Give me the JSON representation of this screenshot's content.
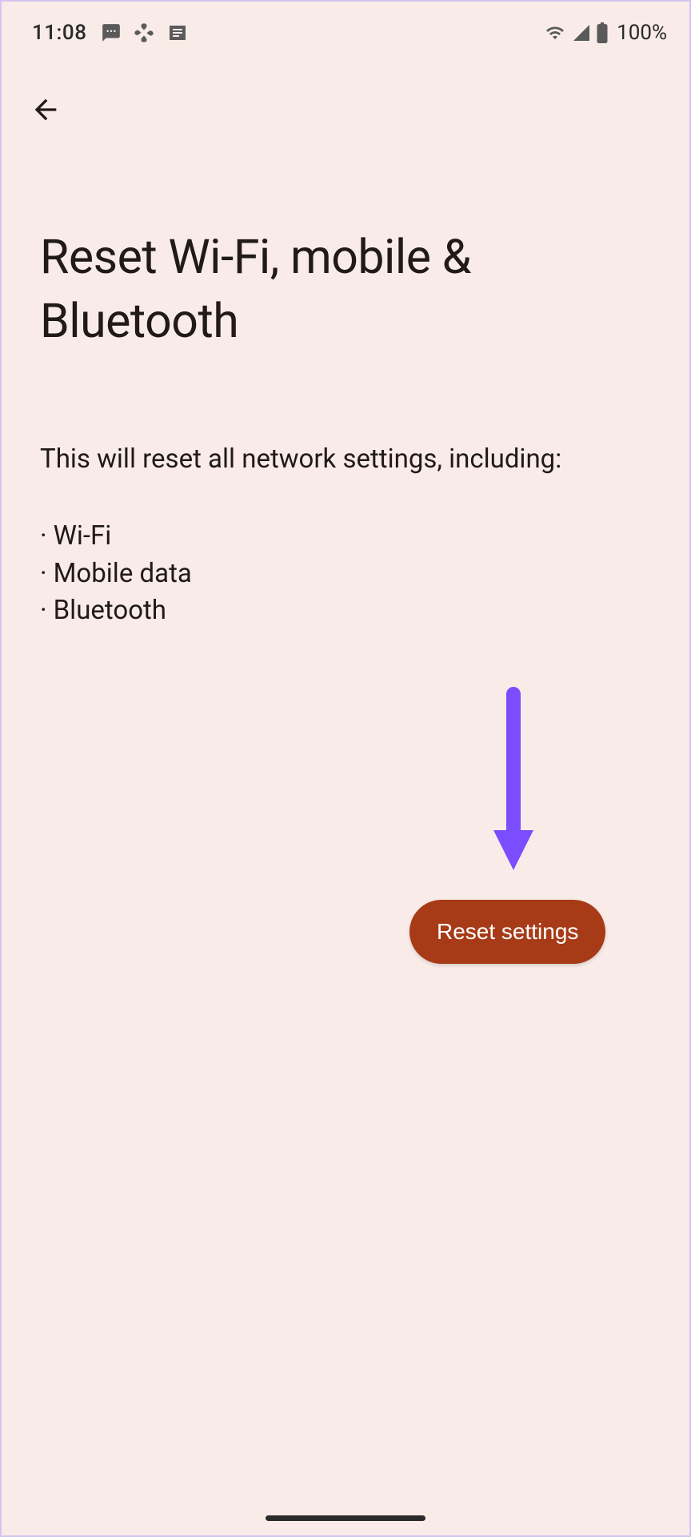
{
  "statusbar": {
    "time": "11:08",
    "battery_percent": "100%"
  },
  "page": {
    "title": "Reset Wi-Fi, mobile & Bluetooth",
    "description": "This will reset all network settings, including:",
    "bullets": [
      "Wi-Fi",
      "Mobile data",
      "Bluetooth"
    ]
  },
  "actions": {
    "reset_label": "Reset settings"
  }
}
